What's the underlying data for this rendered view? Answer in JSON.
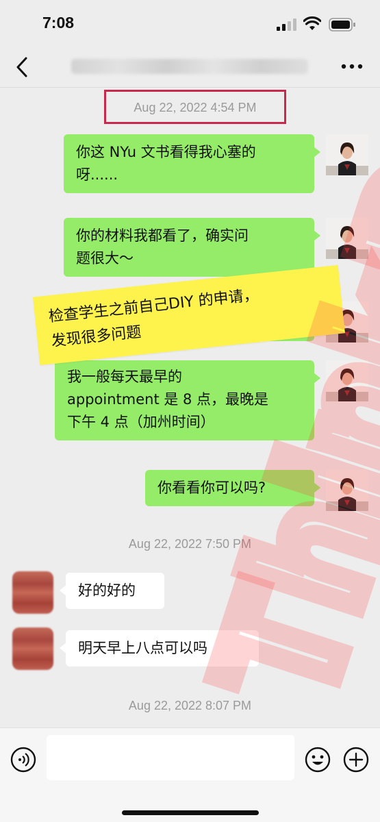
{
  "status_bar": {
    "time": "7:08"
  },
  "watermark": {
    "text": "ThinkPro"
  },
  "messages": [
    {
      "timestamp": "Aug 22, 2022 4:54 PM"
    },
    {
      "sender": "me",
      "lines": [
        "你这 NYu 文书看得我心塞的",
        "呀......"
      ]
    },
    {
      "sender": "me",
      "lines": [
        "你的材料我都看了，确实问",
        "题很大～"
      ]
    },
    {
      "sender": "me",
      "lines": [
        "我一般每天最早的",
        "appointment 是 8 点，最晚是",
        "下午 4 点（加州时间）"
      ]
    },
    {
      "sender": "me",
      "lines": [
        "你看看你可以吗?"
      ]
    },
    {
      "timestamp": "Aug 22, 2022 7:50 PM"
    },
    {
      "sender": "them",
      "lines": [
        "好的好的"
      ]
    },
    {
      "sender": "them",
      "lines": [
        "明天早上八点可以吗"
      ]
    },
    {
      "timestamp": "Aug 22, 2022 8:07 PM"
    }
  ],
  "annotation_note": {
    "lines": [
      "检查学生之前自己DIY 的申请，",
      "发现很多问题"
    ]
  },
  "input_bar": {
    "placeholder": ""
  },
  "icons": {
    "back": "chevron-left-icon",
    "more": "ellipsis-icon",
    "voice": "voice-icon",
    "emoji": "smiley-icon",
    "plus": "plus-icon"
  },
  "colors": {
    "background": "#ededed",
    "my_bubble": "#95ec69",
    "their_bubble": "#ffffff",
    "note": "#fef24d",
    "highlight_box": "#c8284c",
    "timestamp_text": "#9a9a9a"
  }
}
